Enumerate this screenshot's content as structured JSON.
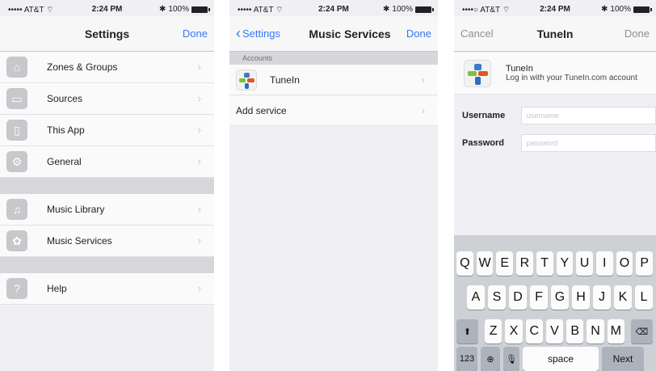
{
  "status": {
    "carrier": "••••• AT&T",
    "carrier3": "••••○ AT&T",
    "wifi": "⌔",
    "time": "2:24 PM",
    "battery": "100%"
  },
  "settings": {
    "title": "Settings",
    "done": "Done",
    "items": [
      {
        "label": "Zones & Groups",
        "icon": "house-icon"
      },
      {
        "label": "Sources",
        "icon": "sources-icon"
      },
      {
        "label": "This App",
        "icon": "phone-icon"
      },
      {
        "label": "General",
        "icon": "gear-icon"
      },
      {
        "label": "Music Library",
        "icon": "music-note-icon"
      },
      {
        "label": "Music Services",
        "icon": "music-services-icon"
      },
      {
        "label": "Help",
        "icon": "help-icon"
      }
    ]
  },
  "music_services": {
    "back": "Settings",
    "title": "Music Services",
    "done": "Done",
    "section": "Accounts",
    "service_name": "TuneIn",
    "add_service": "Add service"
  },
  "tunein": {
    "cancel": "Cancel",
    "title": "TuneIn",
    "done": "Done",
    "account_name": "TuneIn",
    "account_desc": "Log in with your TuneIn.com account",
    "username_label": "Username",
    "username_placeholder": "username",
    "password_label": "Password",
    "password_placeholder": "password"
  },
  "keyboard": {
    "row1": [
      "Q",
      "W",
      "E",
      "R",
      "T",
      "Y",
      "U",
      "I",
      "O",
      "P"
    ],
    "row2": [
      "A",
      "S",
      "D",
      "F",
      "G",
      "H",
      "J",
      "K",
      "L"
    ],
    "row3": [
      "Z",
      "X",
      "C",
      "V",
      "B",
      "N",
      "M"
    ],
    "num": "123",
    "space": "space",
    "next": "Next"
  },
  "colors": {
    "accent": "#3478f6",
    "muted": "#8e8e93"
  }
}
